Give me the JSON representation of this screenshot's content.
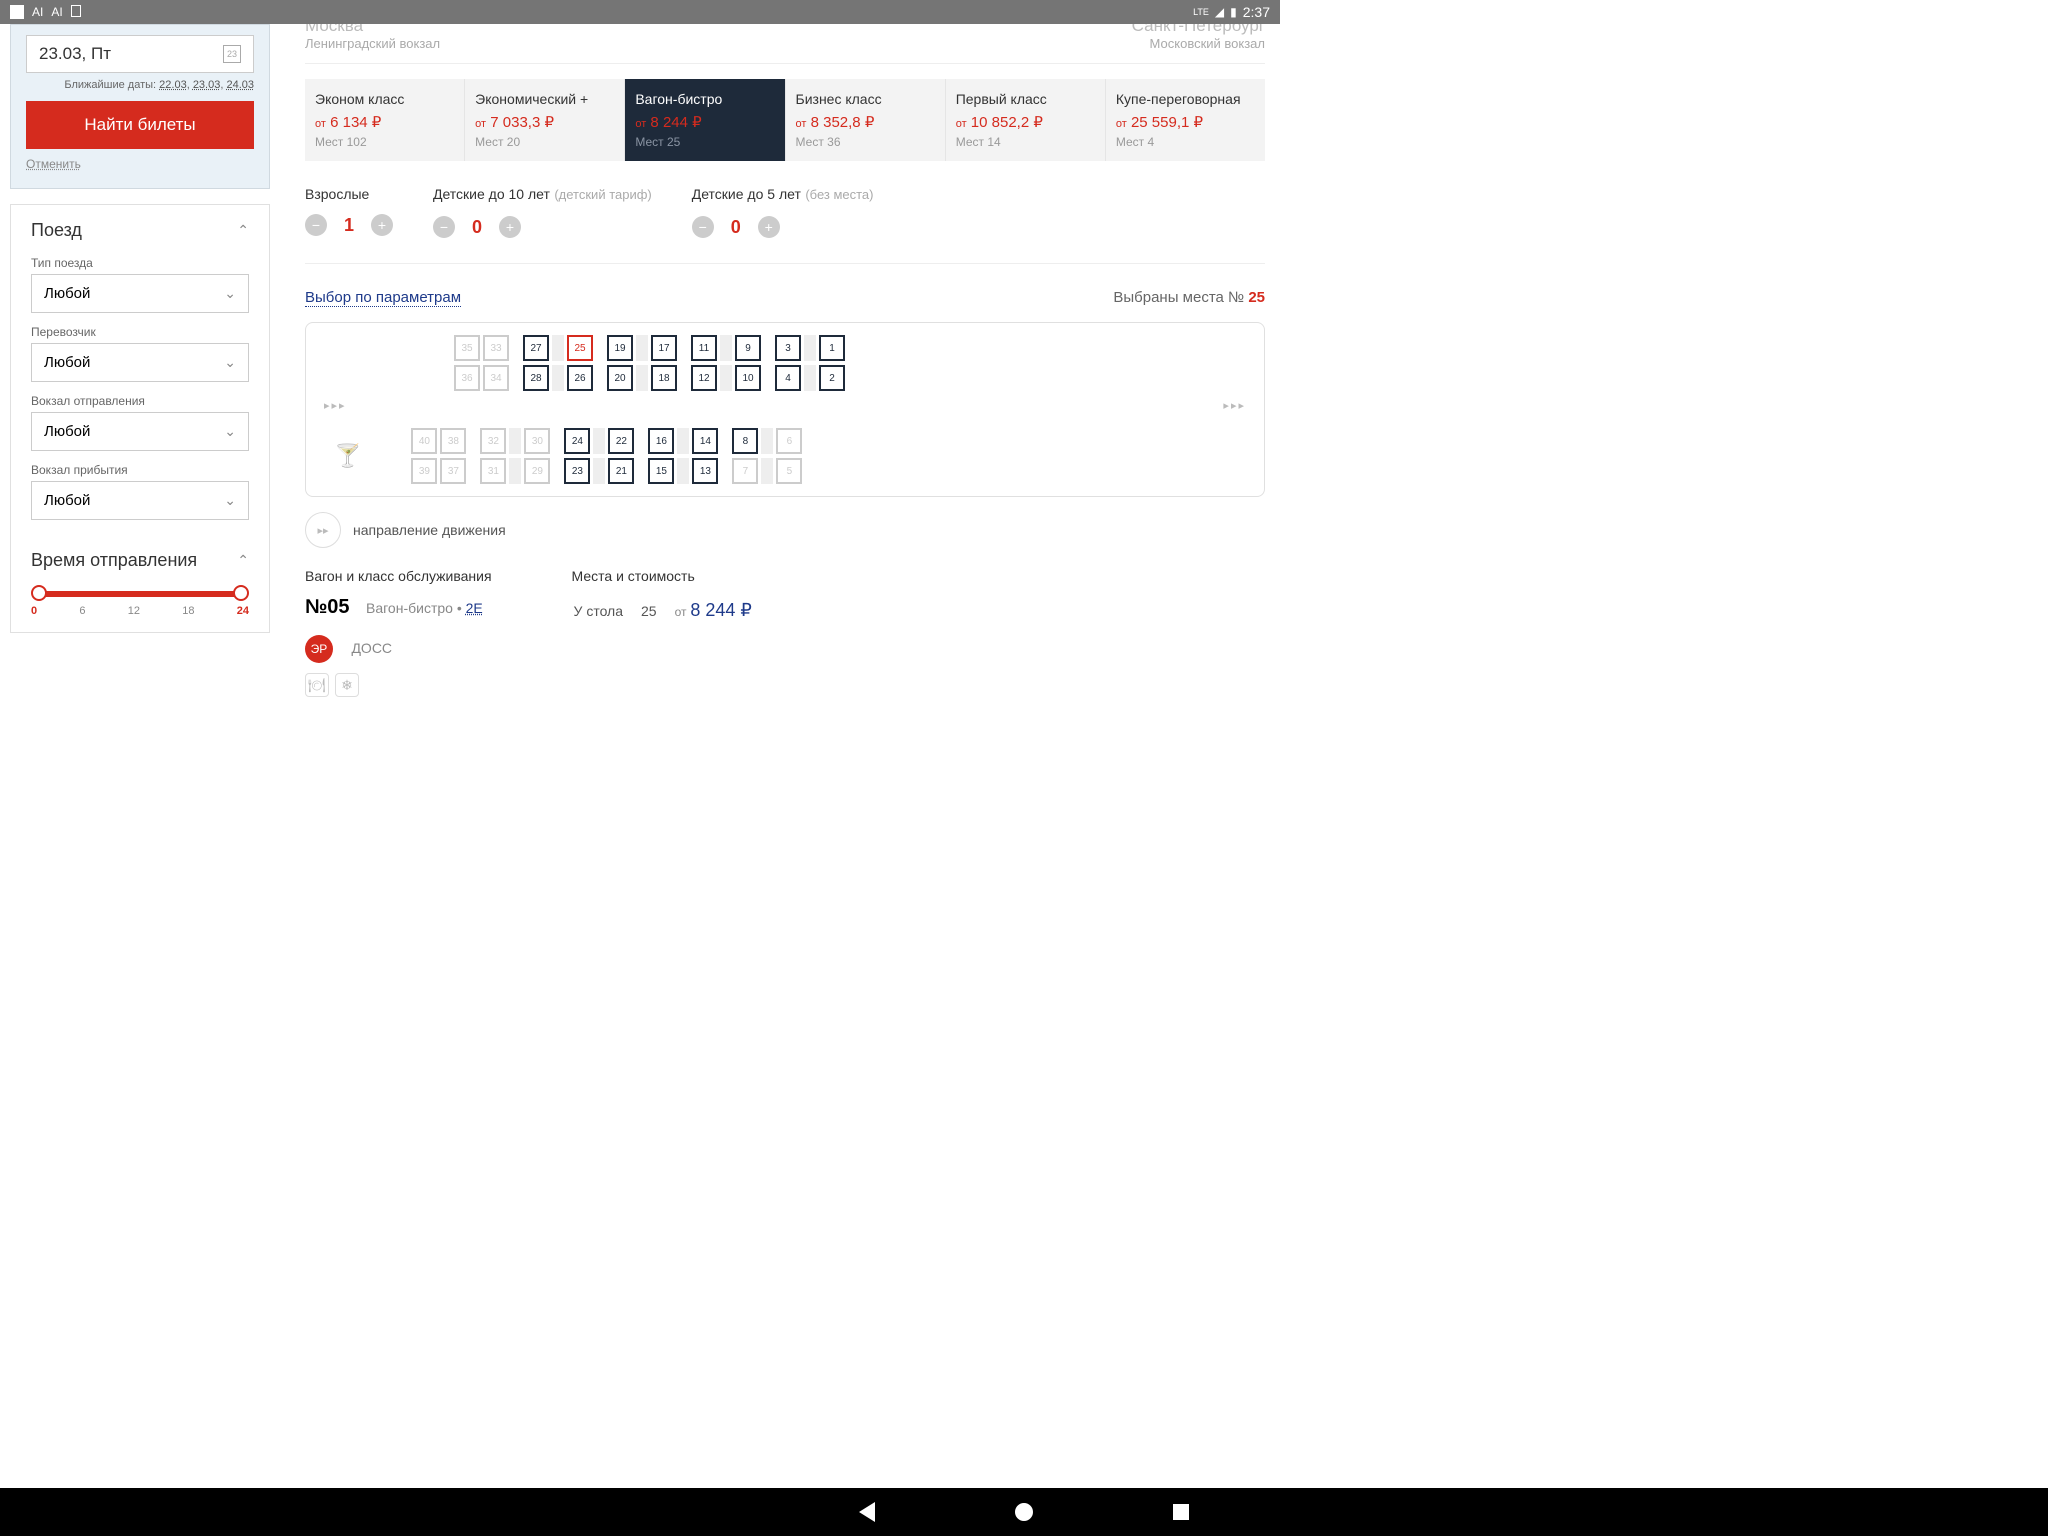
{
  "status": {
    "lte": "LTE",
    "time": "2:37"
  },
  "search": {
    "date": "23.03, Пт",
    "nearest_label": "Ближайшие даты:",
    "nearest": [
      "22.03",
      "23.03",
      "24.03"
    ],
    "find_btn": "Найти билеты",
    "cancel": "Отменить"
  },
  "filters": {
    "train_title": "Поезд",
    "type_label": "Тип поезда",
    "type_value": "Любой",
    "carrier_label": "Перевозчик",
    "carrier_value": "Любой",
    "dep_station_label": "Вокзал отправления",
    "dep_station_value": "Любой",
    "arr_station_label": "Вокзал прибытия",
    "arr_station_value": "Любой",
    "time_title": "Время отправления",
    "time_marks": [
      "0",
      "6",
      "12",
      "18",
      "24"
    ]
  },
  "route": {
    "from_city": "Москва",
    "from_station": "Ленинградский вокзал",
    "to_city": "Санкт-Петербург",
    "to_station": "Московский вокзал"
  },
  "classes": [
    {
      "name": "Эконом класс",
      "price": "6 134",
      "seats": "Мест 102"
    },
    {
      "name": "Экономический +",
      "price": "7 033,3",
      "seats": "Мест 20"
    },
    {
      "name": "Вагон-бистро",
      "price": "8 244",
      "seats": "Мест 25",
      "active": true
    },
    {
      "name": "Бизнес класс",
      "price": "8 352,8",
      "seats": "Мест 36"
    },
    {
      "name": "Первый класс",
      "price": "10 852,2",
      "seats": "Мест 14"
    },
    {
      "name": "Купе-переговорная",
      "price": "25 559,1",
      "seats": "Мест 4"
    }
  ],
  "pax": {
    "adults_label": "Взрослые",
    "adults_count": "1",
    "child10_label": "Детские до 10 лет",
    "child10_sub": "(детский тариф)",
    "child10_count": "0",
    "child5_label": "Детские до 5 лет",
    "child5_sub": "(без места)",
    "child5_count": "0"
  },
  "seatselect": {
    "params": "Выбор по параметрам",
    "selected_label": "Выбраны места №",
    "selected_num": "25"
  },
  "seats": {
    "row1a": [
      {
        "n": "35"
      },
      {
        "n": "33"
      },
      {
        "n": "27",
        "a": 1
      },
      {
        "n": "25",
        "s": 1
      },
      {
        "n": "19",
        "a": 1
      },
      {
        "n": "17",
        "a": 1
      },
      {
        "n": "11",
        "a": 1
      },
      {
        "n": "9",
        "a": 1
      },
      {
        "n": "3",
        "a": 1
      },
      {
        "n": "1",
        "a": 1
      }
    ],
    "row1b": [
      {
        "n": "36"
      },
      {
        "n": "34"
      },
      {
        "n": "28",
        "a": 1
      },
      {
        "n": "26",
        "a": 1
      },
      {
        "n": "20",
        "a": 1
      },
      {
        "n": "18",
        "a": 1
      },
      {
        "n": "12",
        "a": 1
      },
      {
        "n": "10",
        "a": 1
      },
      {
        "n": "4",
        "a": 1
      },
      {
        "n": "2",
        "a": 1
      }
    ],
    "row2a": [
      {
        "n": "40"
      },
      {
        "n": "38"
      },
      {
        "n": "32"
      },
      {
        "n": "30"
      },
      {
        "n": "24",
        "a": 1
      },
      {
        "n": "22",
        "a": 1
      },
      {
        "n": "16",
        "a": 1
      },
      {
        "n": "14",
        "a": 1
      },
      {
        "n": "8",
        "a": 1
      },
      {
        "n": "6"
      }
    ],
    "row2b": [
      {
        "n": "39"
      },
      {
        "n": "37"
      },
      {
        "n": "31"
      },
      {
        "n": "29"
      },
      {
        "n": "23",
        "a": 1
      },
      {
        "n": "21",
        "a": 1
      },
      {
        "n": "15",
        "a": 1
      },
      {
        "n": "13",
        "a": 1
      },
      {
        "n": "7"
      },
      {
        "n": "5"
      }
    ]
  },
  "direction": "направление движения",
  "car": {
    "hdr": "Вагон и класс обслуживания",
    "num": "№05",
    "class": "Вагон-бистро",
    "code": "2Е",
    "er": "ЭР",
    "doss": "ДОСС"
  },
  "price": {
    "hdr": "Места и стоимость",
    "row_label": "У стола",
    "row_seat": "25",
    "row_ot": "от",
    "row_price": "8 244 ₽"
  },
  "misc": {
    "ot": "от",
    "rub": "₽",
    "arrows": "▸▸▸"
  }
}
